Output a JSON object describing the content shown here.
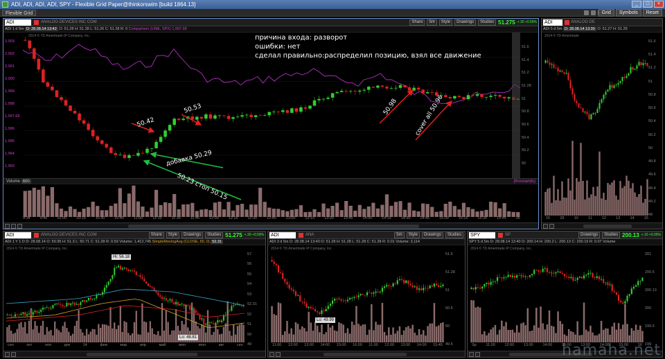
{
  "window": {
    "title": "ADI, ADI, ADI, ADI, SPY - Flexible Grid Paper@thinkorswim [build 1864.13]",
    "grid_label": "Flexible Grid",
    "right_buttons": [
      "Grid",
      "Symbols",
      "Reset"
    ]
  },
  "toolbar_labels": {
    "share": "Share",
    "style": "Style",
    "drawings": "Drawings",
    "studies": "Studies",
    "period": "5m"
  },
  "annotation": {
    "line1": "причина входа: разворот",
    "line2": "ошибки: нет",
    "line3": "сделал правильно:распределил позицию, взял все движение"
  },
  "notes": {
    "n1": "50.42",
    "n2": "50.53",
    "n3": "добавка 50.29",
    "n4": "50.23 стоп 50.15",
    "n5": "50.98",
    "n6": "cover all 50.96"
  },
  "main": {
    "symbol": "ADI",
    "company": "ANALOG DEVICES INC COM",
    "price": "51.275",
    "change": "+.30 +0.59%",
    "info": {
      "period": "ADI 1 d 5m",
      "date": "D: 28.08.14 13:42",
      "open": "O: 51.28",
      "high": "H: 51.28",
      "low": "L: 51.26",
      "close": "C: 51.28",
      "range": "R: 0",
      "comparison": "Comparison (LINE, SPX)",
      "comparison_value": "1,997.68"
    },
    "copyright": "2014 © TD Ameritrade IP Company, Inc.",
    "left_axis": [
      "2,003",
      "2,002",
      "2,001",
      "2,000",
      "1,999",
      "1,998",
      "1,997.68",
      "1,996",
      "1,995",
      "1,994",
      "1,993"
    ],
    "right_axis": [
      "51.6",
      "51.4",
      "51.2",
      "51.28",
      "51",
      "50.8",
      "50.6",
      "50.4",
      "50.2",
      "50"
    ],
    "volume_label": "Volume",
    "volume_value": "600",
    "volume_right": "(thousands)",
    "time_axis": [
      "9:34",
      "9:45",
      "10:00",
      "10:15",
      "10:30",
      "10:45",
      "11:00",
      "11:15",
      "11:30",
      "11:45",
      "12:00",
      "12:15",
      "12:30",
      "12:45",
      "13:00",
      "13:15",
      "13:30",
      "13:45",
      "14:00",
      "14:15",
      "14:30",
      "14:45",
      "15:00",
      "15:15",
      "15:30",
      "15:45",
      "16"
    ]
  },
  "top_right": {
    "symbol": "ADI",
    "company": "ANALOG DE",
    "period": "ADI 5 d 5m",
    "date": "D: 28.08.14 13:30",
    "open": "O: 51.27",
    "high": "H: 51.29",
    "copyright": "2014 © TD Ameritrade",
    "low_label": "Lo: 49.99",
    "right_axis": [
      "51.6",
      "51.4",
      "51.2",
      "51",
      "50.8",
      "50.6",
      "50.4",
      "50.2",
      "50",
      "49.8",
      "49.6",
      "49.4",
      "49.2",
      "49"
    ],
    "time_axis": [
      "15",
      "29",
      "10",
      "11",
      "12",
      "13",
      "14",
      "15"
    ]
  },
  "bottom_left": {
    "symbol": "ADI",
    "company": "ANALOG DEVICES INC COM",
    "price": "51.275",
    "change": "+.30 +0.59%",
    "info": "ADI 1 Y 1 D  D: 28.08.14  O: 50.95  H: 51.3  L: 50.71  C: 51.28  R: 0.59  Volume: 1,412,745",
    "study": "SimpleMovingAvg (CLOSE, 50, 0)",
    "study_value": "52.31",
    "copyright": "2014 © TD Ameritrade IP Company, Inc.",
    "hi_label": "Hi: 56.18",
    "lo_label": "Lo: 48.81",
    "right_axis": [
      "57",
      "56",
      "55",
      "54",
      "53",
      "52.31",
      "52",
      "51",
      "50",
      "49"
    ],
    "time_axis": [
      "сен",
      "окт",
      "ноя",
      "дек",
      "14",
      "фев",
      "мар",
      "апр",
      "май",
      "июн",
      "июл",
      "авг",
      "сен"
    ]
  },
  "bottom_mid": {
    "symbol": "ADI",
    "company": "ANA",
    "period": "ADI 3 d 5m",
    "info": "D: 28.08.14 13:40  O: 51.28  H: 51.28  L: 51.28  C: 51.28  R: 0.01  Volume: 3,114",
    "copyright": "2014 © TD Ameritrade IP Company, Inc.",
    "lo_label": "Lo: 49.99",
    "right_axis": [
      "51.5",
      "51.28",
      "51",
      "50.5",
      "50",
      "49.5"
    ],
    "time_axis": [
      "11:00",
      "12:00",
      "13:00",
      "14:00",
      "15:00",
      "16:00",
      "11:00",
      "12:00",
      "13:00",
      "14:00",
      "15:45"
    ]
  },
  "bottom_right": {
    "symbol": "SPY",
    "company": "SP",
    "price": "200.13",
    "change": "+.10 +0.05%",
    "info": "SPY 5 d 5m  D: 28.08.14 13:40  O: 200.14  H: 200.2  L: 200.13  C: 200.19  R: 0.07  Volume",
    "copyright": "2014 © TD Ameritrade IP Company, Inc.",
    "right_axis": [
      "201",
      "200.5",
      "200.13",
      "200",
      "199.5",
      "199"
    ],
    "time_axis": [
      "Sp",
      "11:00",
      "12:00",
      "13:00",
      "14:00",
      "15:00",
      "13:00",
      "14:00",
      "15:00",
      "16"
    ]
  },
  "watermark": "hamaha.net",
  "colors": {
    "up": "#33cc33",
    "down": "#dd2222",
    "comparison": "#b030c0",
    "volume": "#8a6a6a",
    "sma_red": "#dd2222",
    "sma_cyan": "#33aacc",
    "sma_orange": "#e0a020"
  }
}
